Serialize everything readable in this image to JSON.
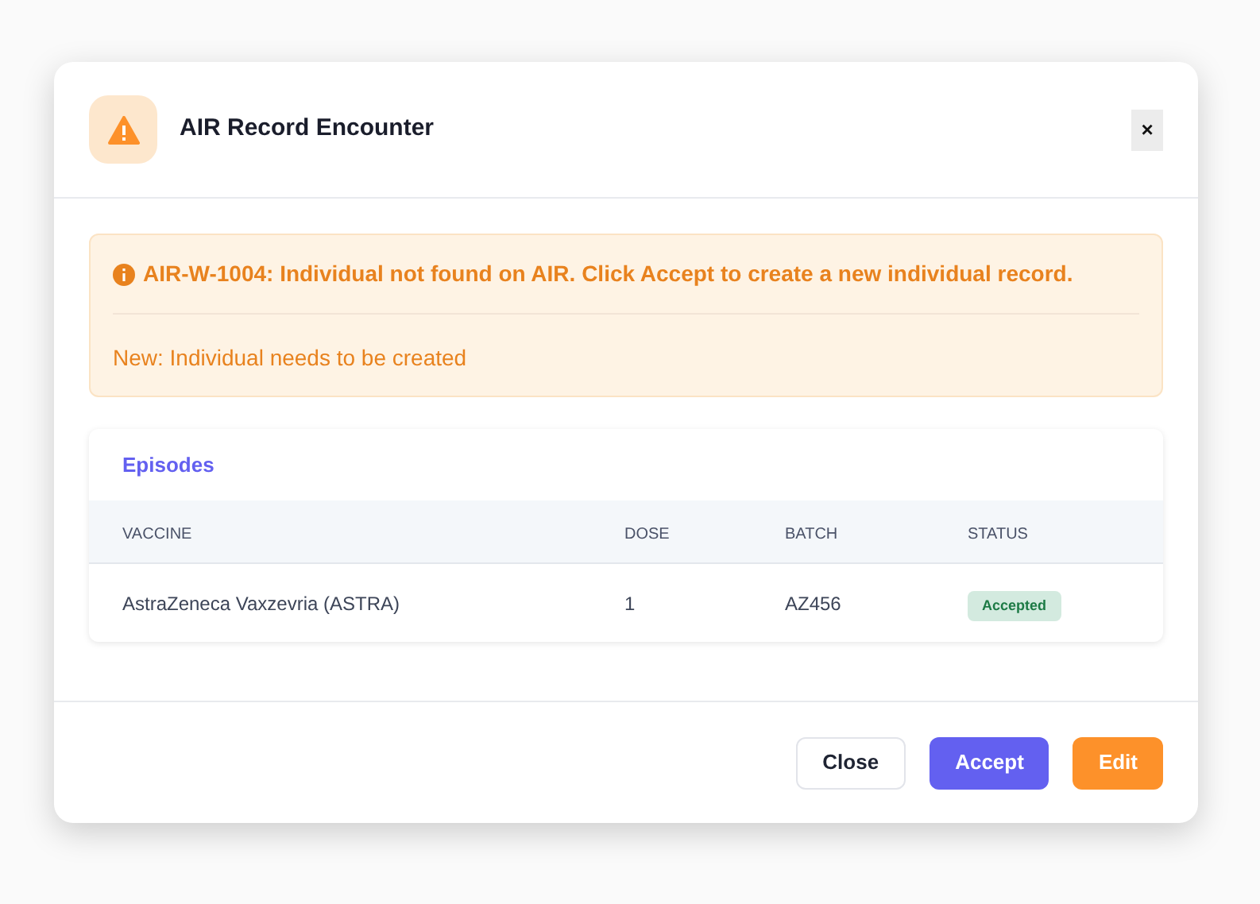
{
  "dialog": {
    "title": "AIR Record Encounter",
    "close_label": "×"
  },
  "alert": {
    "code_message": "AIR-W-1004: Individual not found on AIR. Click Accept to create a new individual record.",
    "detail": "New: Individual needs to be created"
  },
  "episodes": {
    "title": "Episodes",
    "columns": [
      "VACCINE",
      "DOSE",
      "BATCH",
      "STATUS"
    ],
    "rows": [
      {
        "vaccine": "AstraZeneca Vaxzevria (ASTRA)",
        "dose": "1",
        "batch": "AZ456",
        "status": "Accepted",
        "color": "#d3eadf"
      }
    ]
  },
  "buttons": [
    {
      "label": "Close",
      "kind": "secondary"
    },
    {
      "label": "Accept",
      "kind": "primary"
    },
    {
      "label": "Edit",
      "kind": "warning"
    }
  ]
}
